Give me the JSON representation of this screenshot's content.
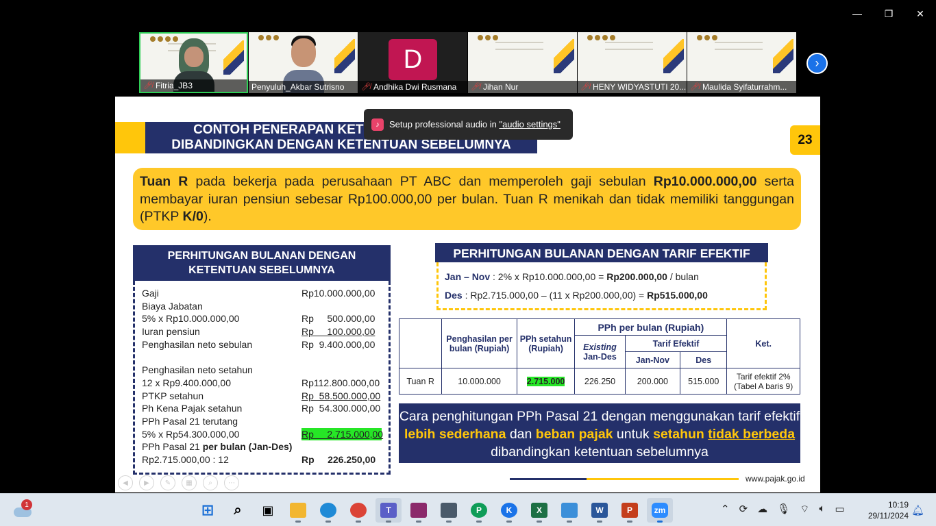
{
  "participants": [
    {
      "name": "Fitria_JB3",
      "muted": true,
      "kind": "woman"
    },
    {
      "name": "Penyuluh_Akbar Sutrisno",
      "muted": false,
      "kind": "man"
    },
    {
      "name": "Andhika Dwi Rusmana",
      "muted": true,
      "kind": "avatar",
      "avatar": "D"
    },
    {
      "name": "Jihan Nur",
      "muted": true,
      "kind": "slide"
    },
    {
      "name": "HENY WIDYASTUTI 20...",
      "muted": true,
      "kind": "slide"
    },
    {
      "name": "Maulida Syifaturrahm...",
      "muted": true,
      "kind": "slide"
    }
  ],
  "toast": {
    "text": "Setup professional audio in ",
    "link": "\"audio settings\""
  },
  "slide": {
    "title_line1": "CONTOH PENERAPAN KETENTUAN PP 58/2023",
    "title_line2": "DIBANDINGKAN DENGAN KETENTUAN SEBELUMNYA",
    "page": "23",
    "intro": {
      "name": "Tuan R",
      "t1": " pada bekerja pada perusahaan PT ABC dan memperoleh gaji sebulan ",
      "salary": "Rp10.000.000,00",
      "t2": " serta membayar iuran pensiun sebesar Rp100.000,00 per bulan. Tuan R menikah dan tidak memiliki tanggungan (PTKP ",
      "ptkp": "K/0",
      "t3": ")."
    },
    "left_header": "PERHITUNGAN BULANAN DENGAN KETENTUAN SEBELUMNYA",
    "left_rows": [
      {
        "label": "Gaji",
        "value": "Rp10.000.000,00"
      },
      {
        "label": "Biaya Jabatan",
        "value": ""
      },
      {
        "label": "5% x Rp10.000.000,00",
        "value": "Rp     500.000,00"
      },
      {
        "label": "Iuran pensiun",
        "value": "Rp     100.000,00",
        "underline": true
      },
      {
        "label": "Penghasilan neto sebulan",
        "value": "Rp  9.400.000,00"
      },
      {
        "label": "",
        "value": ""
      },
      {
        "label": "Penghasilan neto setahun",
        "value": ""
      },
      {
        "label": "12 x Rp9.400.000,00",
        "value": "Rp112.800.000,00"
      },
      {
        "label": "PTKP setahun",
        "value": "Rp  58.500.000,00",
        "underline": true
      },
      {
        "label": "Ph Kena Pajak setahun",
        "value": "Rp  54.300.000,00"
      },
      {
        "label": "PPh Pasal 21 terutang",
        "value": ""
      },
      {
        "label": "5% x Rp54.300.000,00",
        "value": "Rp     2.715.000,00",
        "underline": true,
        "highlight": true
      },
      {
        "label": "PPh Pasal 21 ",
        "label_bold": "per bulan (Jan-Des)",
        "value": ""
      },
      {
        "label": "Rp2.715.000,00 : 12",
        "value": "Rp     226.250,00",
        "bold": true
      }
    ],
    "right_header": "PERHITUNGAN BULANAN DENGAN TARIF EFEKTIF",
    "right_line1": {
      "period": "Jan – Nov",
      "calc": " : 2% x Rp10.000.000,00 = ",
      "result": "Rp200.000,00",
      "suffix": " / bulan"
    },
    "right_line2": {
      "period": "Des",
      "calc": " : Rp2.715.000,00 – (11 x Rp200.000,00) = ",
      "result": "Rp515.000,00"
    },
    "table": {
      "h_income": "Penghasilan per bulan (Rupiah)",
      "h_pph_year": "PPh setahun (Rupiah)",
      "h_pph_month": "PPh per bulan (Rupiah)",
      "h_existing": "Existing",
      "h_existing2": "Jan-Des",
      "h_tarif": "Tarif Efektif",
      "h_jannov": "Jan-Nov",
      "h_des": "Des",
      "h_ket": "Ket.",
      "row": {
        "name": "Tuan R",
        "income": "10.000.000",
        "pph_year": "2.715.000",
        "existing": "226.250",
        "jannov": "200.000",
        "des": "515.000",
        "ket": "Tarif efektif 2% (Tabel A baris 9)"
      }
    },
    "summary": {
      "a": "Cara penghitungan PPh Pasal 21 dengan menggunakan tarif efektif ",
      "b": "lebih sederhana",
      "c": " dan ",
      "d": "beban pajak",
      "e": " untuk ",
      "f": "setahun",
      "g": "tidak berbeda",
      "h": " dibandingkan ketentuan sebelumnya"
    },
    "footer_url": "www.pajak.go.id"
  },
  "taskbar": {
    "notification_count": "1",
    "time": "10:19",
    "date": "29/11/2024",
    "apps": [
      "start-icon",
      "search-icon",
      "task-view-icon",
      "file-explorer-icon",
      "edge-icon",
      "chrome-icon",
      "teams-icon",
      "winrar-icon",
      "snipping-icon",
      "chrome-profile-p-icon",
      "chrome-profile-k-icon",
      "excel-icon",
      "photos-icon",
      "word-icon",
      "powerpoint-icon",
      "zoom-icon"
    ]
  },
  "colors": {
    "navy": "#24306a",
    "yellow": "#ffc60b",
    "highlight_green": "#26e626",
    "zoom_blue": "#1b72e8"
  }
}
